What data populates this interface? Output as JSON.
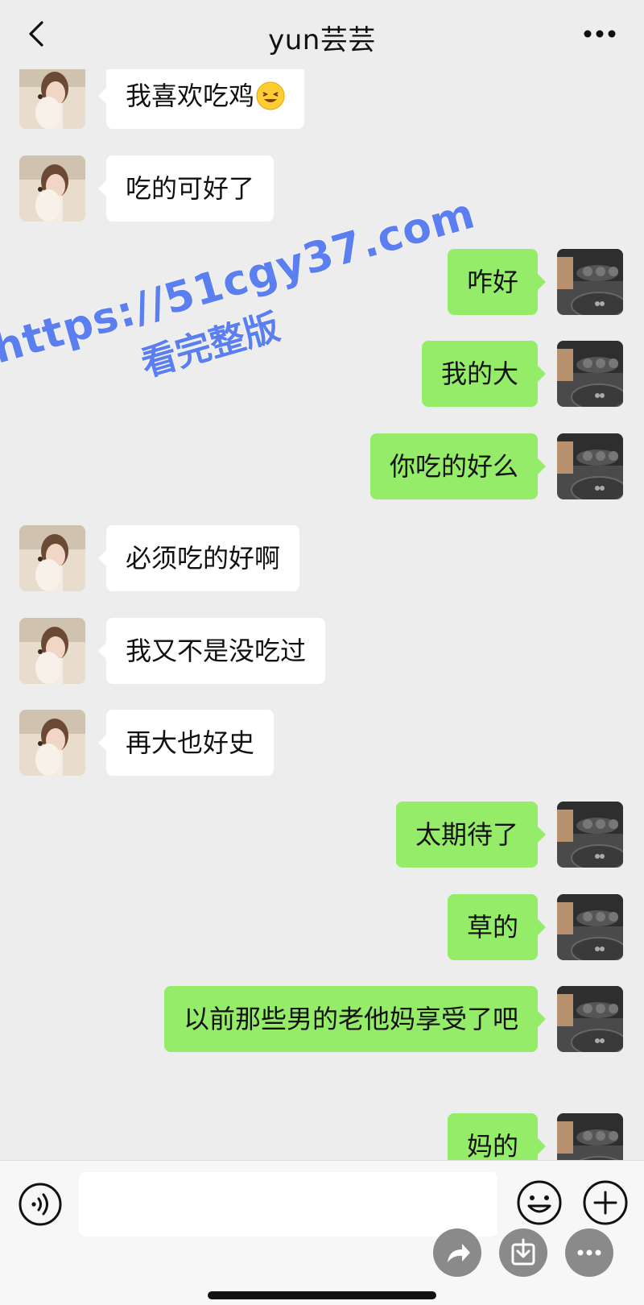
{
  "header": {
    "title": "yun芸芸",
    "back_icon": "chevron-left-icon",
    "more_icon": "more-dots-icon"
  },
  "messages": [
    {
      "side": "left",
      "text": "我喜欢吃鸡",
      "emoji": "grinning-squint-emoji"
    },
    {
      "side": "left",
      "text": "吃的可好了"
    },
    {
      "side": "right",
      "text": "咋好"
    },
    {
      "side": "right",
      "text": "我的大"
    },
    {
      "side": "right",
      "text": "你吃的好么"
    },
    {
      "side": "left",
      "text": "必须吃的好啊"
    },
    {
      "side": "left",
      "text": "我又不是没吃过"
    },
    {
      "side": "left",
      "text": "再大也好史"
    },
    {
      "side": "right",
      "text": "太期待了"
    },
    {
      "side": "right",
      "text": "草的"
    },
    {
      "side": "right",
      "text": "以前那些男的老他妈享受了吧"
    },
    {
      "side": "right",
      "text": "妈的"
    }
  ],
  "watermark": {
    "line1": "https://51cgy37.com",
    "line2": "看完整版"
  },
  "input_bar": {
    "input_value": "",
    "voice_icon": "voice-icon",
    "emoji_icon": "smiley-icon",
    "plus_icon": "plus-circle-icon"
  },
  "floating_actions": {
    "share_icon": "share-arrow-icon",
    "download_icon": "download-icon",
    "menu_icon": "more-dots-icon"
  },
  "colors": {
    "background": "#ededed",
    "outgoing_bubble": "#95ec69",
    "incoming_bubble": "#ffffff",
    "watermark": "#5b7ff0"
  }
}
